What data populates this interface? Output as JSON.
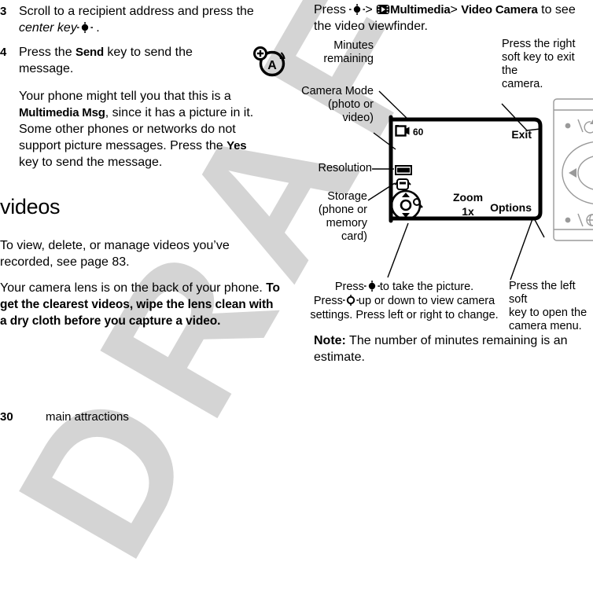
{
  "document": {
    "watermark": "DRAFT",
    "footer": {
      "page_number": "30",
      "chapter": "main attractions"
    }
  },
  "left_column": {
    "steps": [
      {
        "number": "3",
        "text_before": "Scroll to a recipient address and press the ",
        "italic": "center key",
        "text_after": " ."
      },
      {
        "number": "4",
        "text_before": "Press the ",
        "bold": "Send",
        "text_after": " key to send the message."
      }
    ],
    "paragraph_parts": {
      "p1_a": "Your phone might tell you that this is a ",
      "p1_b": "Multimedia Msg",
      "p1_c": ", since it has a picture in it. Some other phones or networks do not support picture messages. Press the ",
      "p1_d": "Yes",
      "p1_e": " key to send the message."
    },
    "section_heading": "videos",
    "paragraphs": [
      "To view, delete, or manage videos you’ve recorded, see page 83."
    ],
    "paragraph2": {
      "normal": "Your camera lens is on the back of your phone. ",
      "bold": "To get the clearest videos, wipe the lens clean with a dry cloth before you capture a video."
    },
    "margin_icon": "mms-audio-icon"
  },
  "right_column": {
    "intro": {
      "press": "Press",
      "center_key_icon": "center-key-icon",
      "sep1": ">",
      "multimedia_icon": "multimedia-icon",
      "multimedia": "Multimedia",
      "sep2": ">",
      "video_camera": "Video Camera",
      "tail": "to see the video viewfinder."
    },
    "diagram": {
      "callouts_left": [
        {
          "name": "minutes-remaining",
          "lines": [
            "Minutes",
            "remaining"
          ]
        },
        {
          "name": "camera-mode",
          "lines": [
            "Camera Mode",
            "(photo or",
            "video)"
          ]
        },
        {
          "name": "resolution",
          "lines": [
            "Resolution"
          ]
        },
        {
          "name": "storage",
          "lines": [
            "Storage",
            "(phone or",
            "memory card)"
          ]
        }
      ],
      "callouts_right": [
        {
          "name": "exit-softkey-note",
          "lines": [
            "Press the right",
            "soft key to exit the",
            "camera."
          ]
        },
        {
          "name": "menu-softkey-note",
          "lines": [
            "Press the left soft",
            "key to open the",
            "camera menu."
          ]
        }
      ],
      "callouts_bottom": [
        {
          "name": "center-key-note",
          "lines": [
            "Press  to take the picture.",
            "Press  up or down to view camera",
            "settings. Press left or right to change."
          ]
        }
      ],
      "viewfinder": {
        "camera_mode_icon": "video-camera-icon",
        "minutes_remaining": "60",
        "resolution_icon": "resolution-icon",
        "storage_icon": "storage-phone-icon",
        "nav_zoom_icon": "nav-zoom-icon",
        "zoom_label": "Zoom",
        "zoom_value": "1x",
        "left_softkey": "Options",
        "right_softkey": "Exit"
      },
      "phone_illustration": {
        "name": "phone-keypad-illustration",
        "keys": [
          "power-key-icon",
          "nav-disc-icon",
          "web-key-icon"
        ]
      }
    },
    "note": {
      "label": "Note:",
      "text": " The number of minutes remaining is an estimate."
    }
  },
  "colors": {
    "ink": "#000000",
    "watermark": "#d4d4d4",
    "phone_outline": "#9a9a9a"
  }
}
